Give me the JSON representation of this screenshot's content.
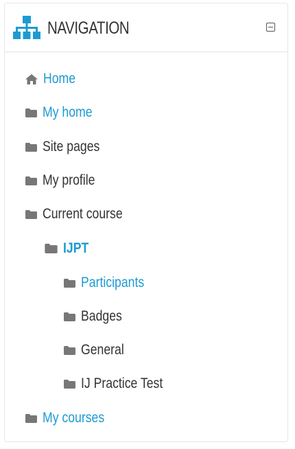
{
  "header": {
    "title": "NAVIGATION"
  },
  "nav": {
    "home": "Home",
    "my_home": "My home",
    "site_pages": "Site pages",
    "my_profile": "My profile",
    "current_course": "Current course",
    "course": "IJPT",
    "participants": "Participants",
    "badges": "Badges",
    "general": "General",
    "practice_test": "IJ Practice Test",
    "my_courses": "My courses"
  },
  "colors": {
    "link": "#1d9bd1",
    "text": "#333333",
    "icon": "#777777",
    "header_icon": "#1d9bd1"
  }
}
